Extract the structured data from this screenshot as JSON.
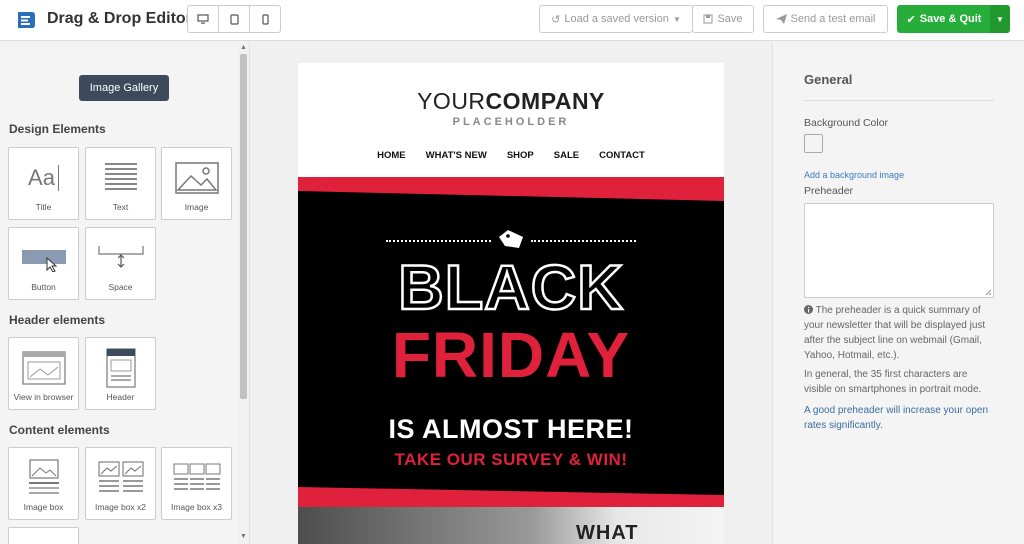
{
  "app": {
    "title": "Drag & Drop Editor"
  },
  "toolbar": {
    "load_label": "Load a saved version",
    "save_label": "Save",
    "test_label": "Send a test email",
    "save_quit_label": "Save & Quit"
  },
  "sidebar": {
    "gallery_button": "Image Gallery",
    "design_heading": "Design Elements",
    "design_items": [
      "Title",
      "Text",
      "Image",
      "Button",
      "Space"
    ],
    "header_heading": "Header elements",
    "header_items": [
      "View in browser",
      "Header"
    ],
    "content_heading": "Content elements",
    "content_items": [
      "Image box",
      "Image box x2",
      "Image box x3"
    ],
    "title_glyph": "Aa"
  },
  "canvas": {
    "company_regular": "YOUR",
    "company_bold": "COMPANY",
    "company_sub": "PLACEHOLDER",
    "nav": [
      "HOME",
      "WHAT'S NEW",
      "SHOP",
      "SALE",
      "CONTACT"
    ],
    "hero_line1": "BLACK",
    "hero_line2": "FRIDAY",
    "hero_line3": "IS ALMOST HERE!",
    "hero_line4": "TAKE OUR SURVEY & WIN!",
    "photo_caption": "WHAT",
    "colors": {
      "hero_bg": "#000000",
      "accent": "#e0213b"
    }
  },
  "panel": {
    "heading": "General",
    "bg_color_label": "Background Color",
    "bg_image_link": "Add a background image",
    "preheader_label": "Preheader",
    "info_1": "The preheader is a quick summary of your newsletter that will be displayed just after the subject line on webmail (Gmail, Yahoo, Hotmail, etc.).",
    "info_2": "In general, the 35 first characters are visible on smartphones in portrait mode.",
    "info_3": "A good preheader will increase your open rates significantly."
  },
  "colors": {
    "save_quit": "#27ae3a",
    "gallery_button": "#3d4a5c",
    "link": "#3a7bbf"
  }
}
